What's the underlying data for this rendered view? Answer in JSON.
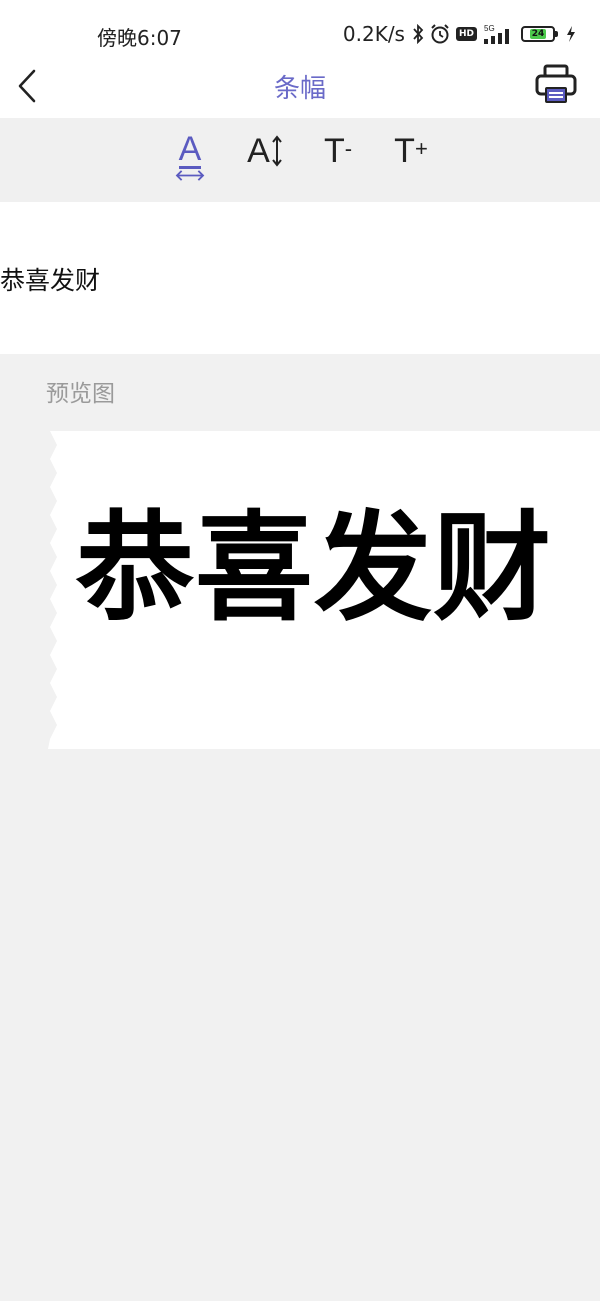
{
  "status_bar": {
    "time": "傍晚6:07",
    "net_speed": "0.2K/s",
    "hd_label": "HD",
    "battery_level": "24",
    "battery_fill_fraction": 0.6,
    "icons": [
      "bluetooth-icon",
      "alarm-icon",
      "hd-icon",
      "5g-signal-icon",
      "battery-icon",
      "charging-icon"
    ]
  },
  "nav": {
    "title": "条幅",
    "back_icon": "chevron-left-icon",
    "print_icon": "printer-icon"
  },
  "toolbar": {
    "items": [
      {
        "label": "A",
        "icon": "text-width-icon",
        "selected": true
      },
      {
        "label": "A",
        "icon": "text-height-icon",
        "selected": false
      },
      {
        "label": "T",
        "suffix": "-",
        "icon": "font-decrease-icon",
        "selected": false
      },
      {
        "label": "T",
        "suffix": "+",
        "icon": "font-increase-icon",
        "selected": false
      }
    ],
    "accent_color": "#5b5bc0"
  },
  "input": {
    "value": "恭喜发财"
  },
  "preview": {
    "label": "预览图",
    "banner_text": "恭喜发财"
  },
  "colors": {
    "title": "#6a6ac8",
    "toolbar_bg": "#f0f0f0",
    "preview_bg": "#f1f1f1"
  }
}
